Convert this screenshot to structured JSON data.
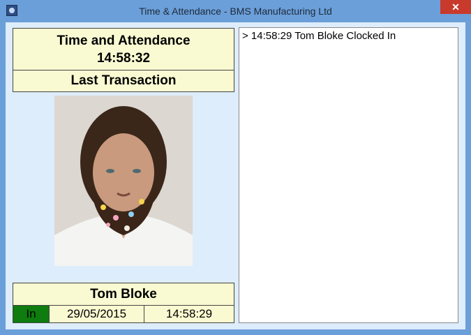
{
  "window": {
    "title": "Time & Attendance - BMS Manufacturing Ltd",
    "close_label": "✕"
  },
  "header": {
    "title": "Time and Attendance",
    "clock": "14:58:32"
  },
  "last_transaction": {
    "label": "Last Transaction",
    "employee_name": "Tom Bloke",
    "status": "In",
    "date": "29/05/2015",
    "time": "14:58:29"
  },
  "log": {
    "entries": [
      "> 14:58:29 Tom Bloke Clocked In"
    ]
  },
  "colors": {
    "status_in": "#0e7c0e",
    "panel_bg": "#fafad2",
    "client_bg": "#deedfb",
    "titlebar": "#6b9fd9"
  },
  "icons": {
    "app": "app-icon",
    "close": "close-icon"
  }
}
